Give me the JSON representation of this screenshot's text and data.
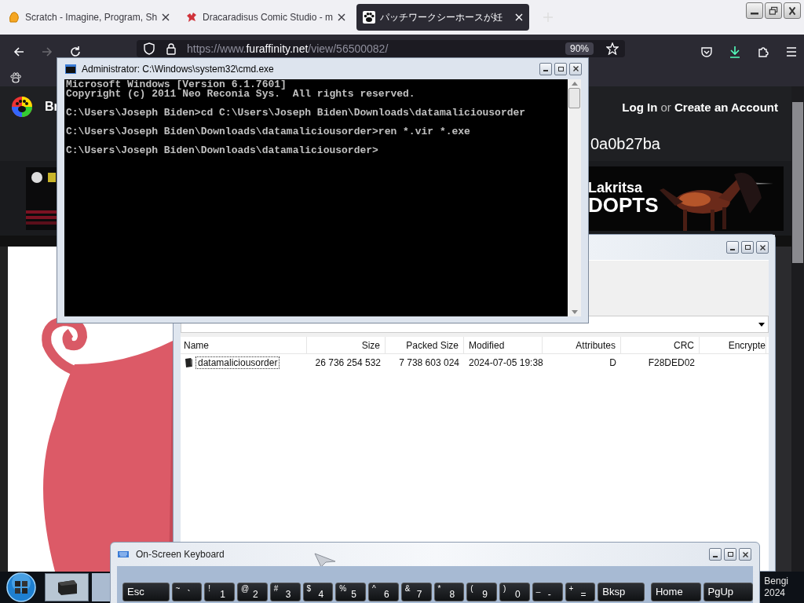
{
  "browser": {
    "tabs": [
      {
        "title": "Scratch - Imagine, Program, Sh",
        "selected": false
      },
      {
        "title": "Dracaradisus Comic Studio - m",
        "selected": false
      },
      {
        "title": "パッチワークシーホースが妊",
        "selected": true
      }
    ],
    "forward": {
      "disabled": true
    },
    "url": {
      "prefix": "https://www.",
      "host": "furaffinity.net",
      "path": "/view/56500082/"
    },
    "zoom": "90%"
  },
  "page": {
    "site_name": "Br",
    "login": "Log In",
    "or": "or",
    "create_account": "Create an Account",
    "hash": "0a0b27ba",
    "banner_lines": [
      "Lakritsa",
      "DOPTS"
    ]
  },
  "cmd": {
    "title": "Administrator: C:\\Windows\\system32\\cmd.exe",
    "lines": [
      "Microsoft Windows [Version 6.1.7601]",
      "Copyright (c) 2011 Neo Reconia Sys.  All rights reserved.",
      "C:\\Users\\Joseph Biden>cd C:\\Users\\Joseph Biden\\Downloads\\datamaliciousorder",
      "C:\\Users\\Joseph Biden\\Downloads\\datamaliciousorder>ren *.vir *.exe",
      "C:\\Users\\Joseph Biden\\Downloads\\datamaliciousorder>"
    ]
  },
  "archive": {
    "columns": [
      "Name",
      "Size",
      "Packed Size",
      "Modified",
      "Attributes",
      "CRC",
      "Encrypte"
    ],
    "rows": [
      {
        "cells": [
          "datamaliciousorder",
          "26 736 254 532",
          "7 738 603 024",
          "2024-07-05 19:38",
          "D",
          "F28DED02"
        ]
      }
    ]
  },
  "keyboard": {
    "title": "On-Screen Keyboard",
    "keys": [
      {
        "main": "Esc",
        "kind": "wide"
      },
      {
        "shift": "~",
        "main": "`",
        "kind": "char"
      },
      {
        "shift": "!",
        "main": "1",
        "kind": "char"
      },
      {
        "shift": "@",
        "main": "2",
        "kind": "char"
      },
      {
        "shift": "#",
        "main": "3",
        "kind": "char"
      },
      {
        "shift": "$",
        "main": "4",
        "kind": "char"
      },
      {
        "shift": "%",
        "main": "5",
        "kind": "char"
      },
      {
        "shift": "^",
        "main": "6",
        "kind": "char"
      },
      {
        "shift": "&",
        "main": "7",
        "kind": "char"
      },
      {
        "shift": "*",
        "main": "8",
        "kind": "char"
      },
      {
        "shift": "(",
        "main": "9",
        "kind": "char"
      },
      {
        "shift": ")",
        "main": "0",
        "kind": "char"
      },
      {
        "shift": "_",
        "main": "-",
        "kind": "char"
      },
      {
        "shift": "+",
        "main": "=",
        "kind": "char"
      },
      {
        "main": "Bksp",
        "kind": "wide"
      },
      {
        "main": "Home",
        "kind": "nav"
      },
      {
        "main": "PgUp",
        "kind": "nav"
      }
    ]
  },
  "taskbar": {
    "clock_lines": [
      "Bengi",
      "2024"
    ]
  }
}
